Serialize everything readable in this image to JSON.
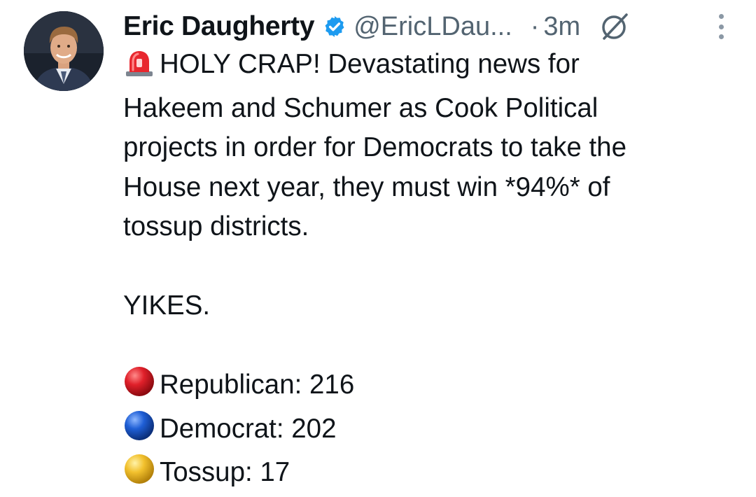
{
  "tweet": {
    "author": {
      "display_name": "Eric Daugherty",
      "handle": "@EricLDau...",
      "verified_icon": "verified-badge-icon",
      "avatar_icon": "profile-photo"
    },
    "separator": "·",
    "timestamp": "3m",
    "header_icon": "grok-icon",
    "menu_icon": "more-options-icon",
    "body": {
      "line1": "HOLY CRAP! Devastating news for",
      "line2": "Hakeem and Schumer as Cook Political",
      "line3": "projects in order for Democrats to take the",
      "line4": "House next year, they must win *94%* of",
      "line5": "tossup districts.",
      "yikes": "YIKES.",
      "stats": [
        {
          "label": "Republican: 216",
          "icon": "red-circle-icon",
          "color": "#d8232a"
        },
        {
          "label": "Democrat: 202",
          "icon": "blue-circle-icon",
          "color": "#1f5fd6"
        },
        {
          "label": "Tossup: 17",
          "icon": "yellow-circle-icon",
          "color": "#f2c12e"
        }
      ]
    }
  }
}
